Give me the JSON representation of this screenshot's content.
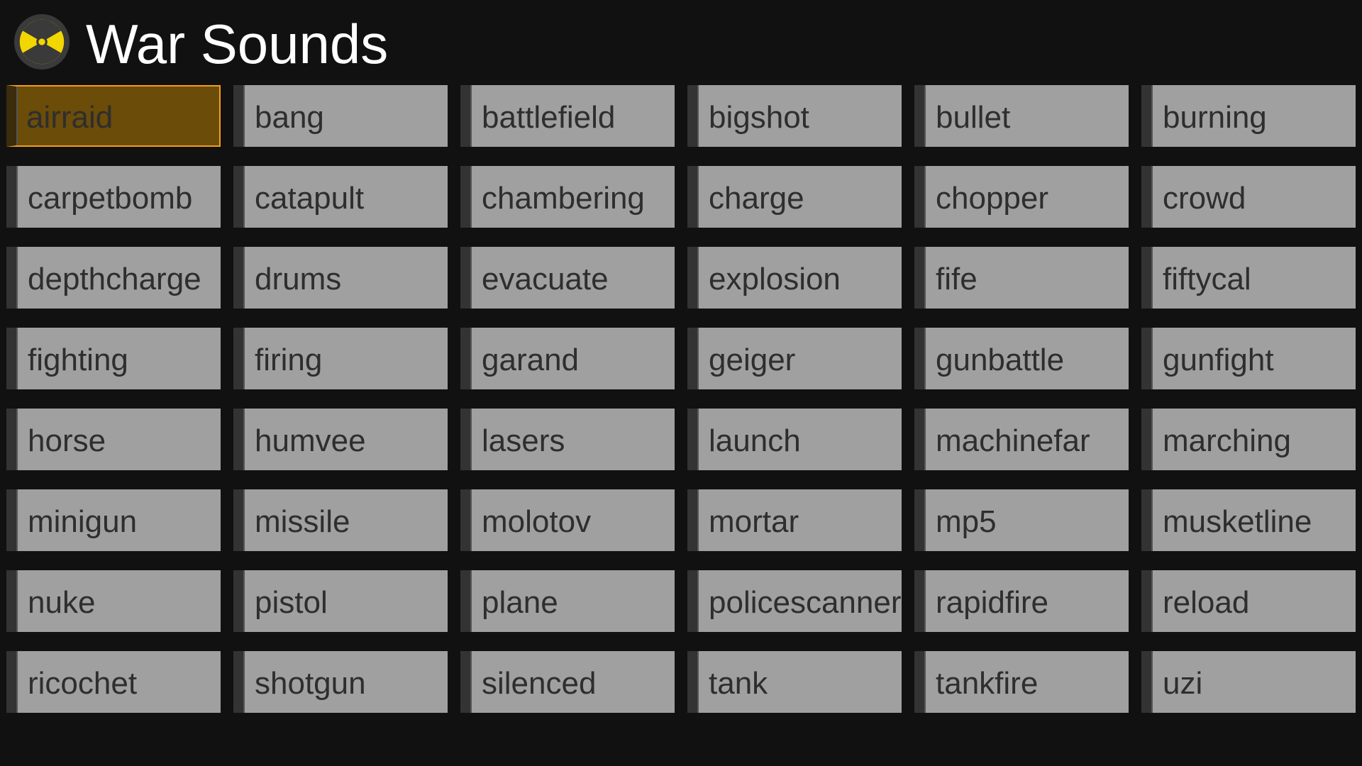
{
  "header": {
    "title": "War Sounds",
    "icon": "radiation-icon",
    "icon_colors": {
      "background": "#3a3a3a",
      "symbol": "#f2d600"
    }
  },
  "colors": {
    "background": "#111111",
    "button": "#a0a0a0",
    "button_text": "#2e2e2e",
    "selected_background": "#6b4c08",
    "selected_border": "#f29d1f"
  },
  "sounds": [
    {
      "label": "airraid",
      "selected": true
    },
    {
      "label": "bang"
    },
    {
      "label": "battlefield"
    },
    {
      "label": "bigshot"
    },
    {
      "label": "bullet"
    },
    {
      "label": "burning"
    },
    {
      "label": "carpetbomb"
    },
    {
      "label": "catapult"
    },
    {
      "label": "chambering"
    },
    {
      "label": "charge"
    },
    {
      "label": "chopper"
    },
    {
      "label": "crowd"
    },
    {
      "label": "depthcharge"
    },
    {
      "label": "drums"
    },
    {
      "label": "evacuate"
    },
    {
      "label": "explosion"
    },
    {
      "label": "fife"
    },
    {
      "label": "fiftycal"
    },
    {
      "label": "fighting"
    },
    {
      "label": "firing"
    },
    {
      "label": "garand"
    },
    {
      "label": "geiger"
    },
    {
      "label": "gunbattle"
    },
    {
      "label": "gunfight"
    },
    {
      "label": "horse"
    },
    {
      "label": "humvee"
    },
    {
      "label": "lasers"
    },
    {
      "label": "launch"
    },
    {
      "label": "machinefar"
    },
    {
      "label": "marching"
    },
    {
      "label": "minigun"
    },
    {
      "label": "missile"
    },
    {
      "label": "molotov"
    },
    {
      "label": "mortar"
    },
    {
      "label": "mp5"
    },
    {
      "label": "musketline"
    },
    {
      "label": "nuke"
    },
    {
      "label": "pistol"
    },
    {
      "label": "plane"
    },
    {
      "label": "policescanner"
    },
    {
      "label": "rapidfire"
    },
    {
      "label": "reload"
    },
    {
      "label": "ricochet"
    },
    {
      "label": "shotgun"
    },
    {
      "label": "silenced"
    },
    {
      "label": "tank"
    },
    {
      "label": "tankfire"
    },
    {
      "label": "uzi"
    }
  ]
}
